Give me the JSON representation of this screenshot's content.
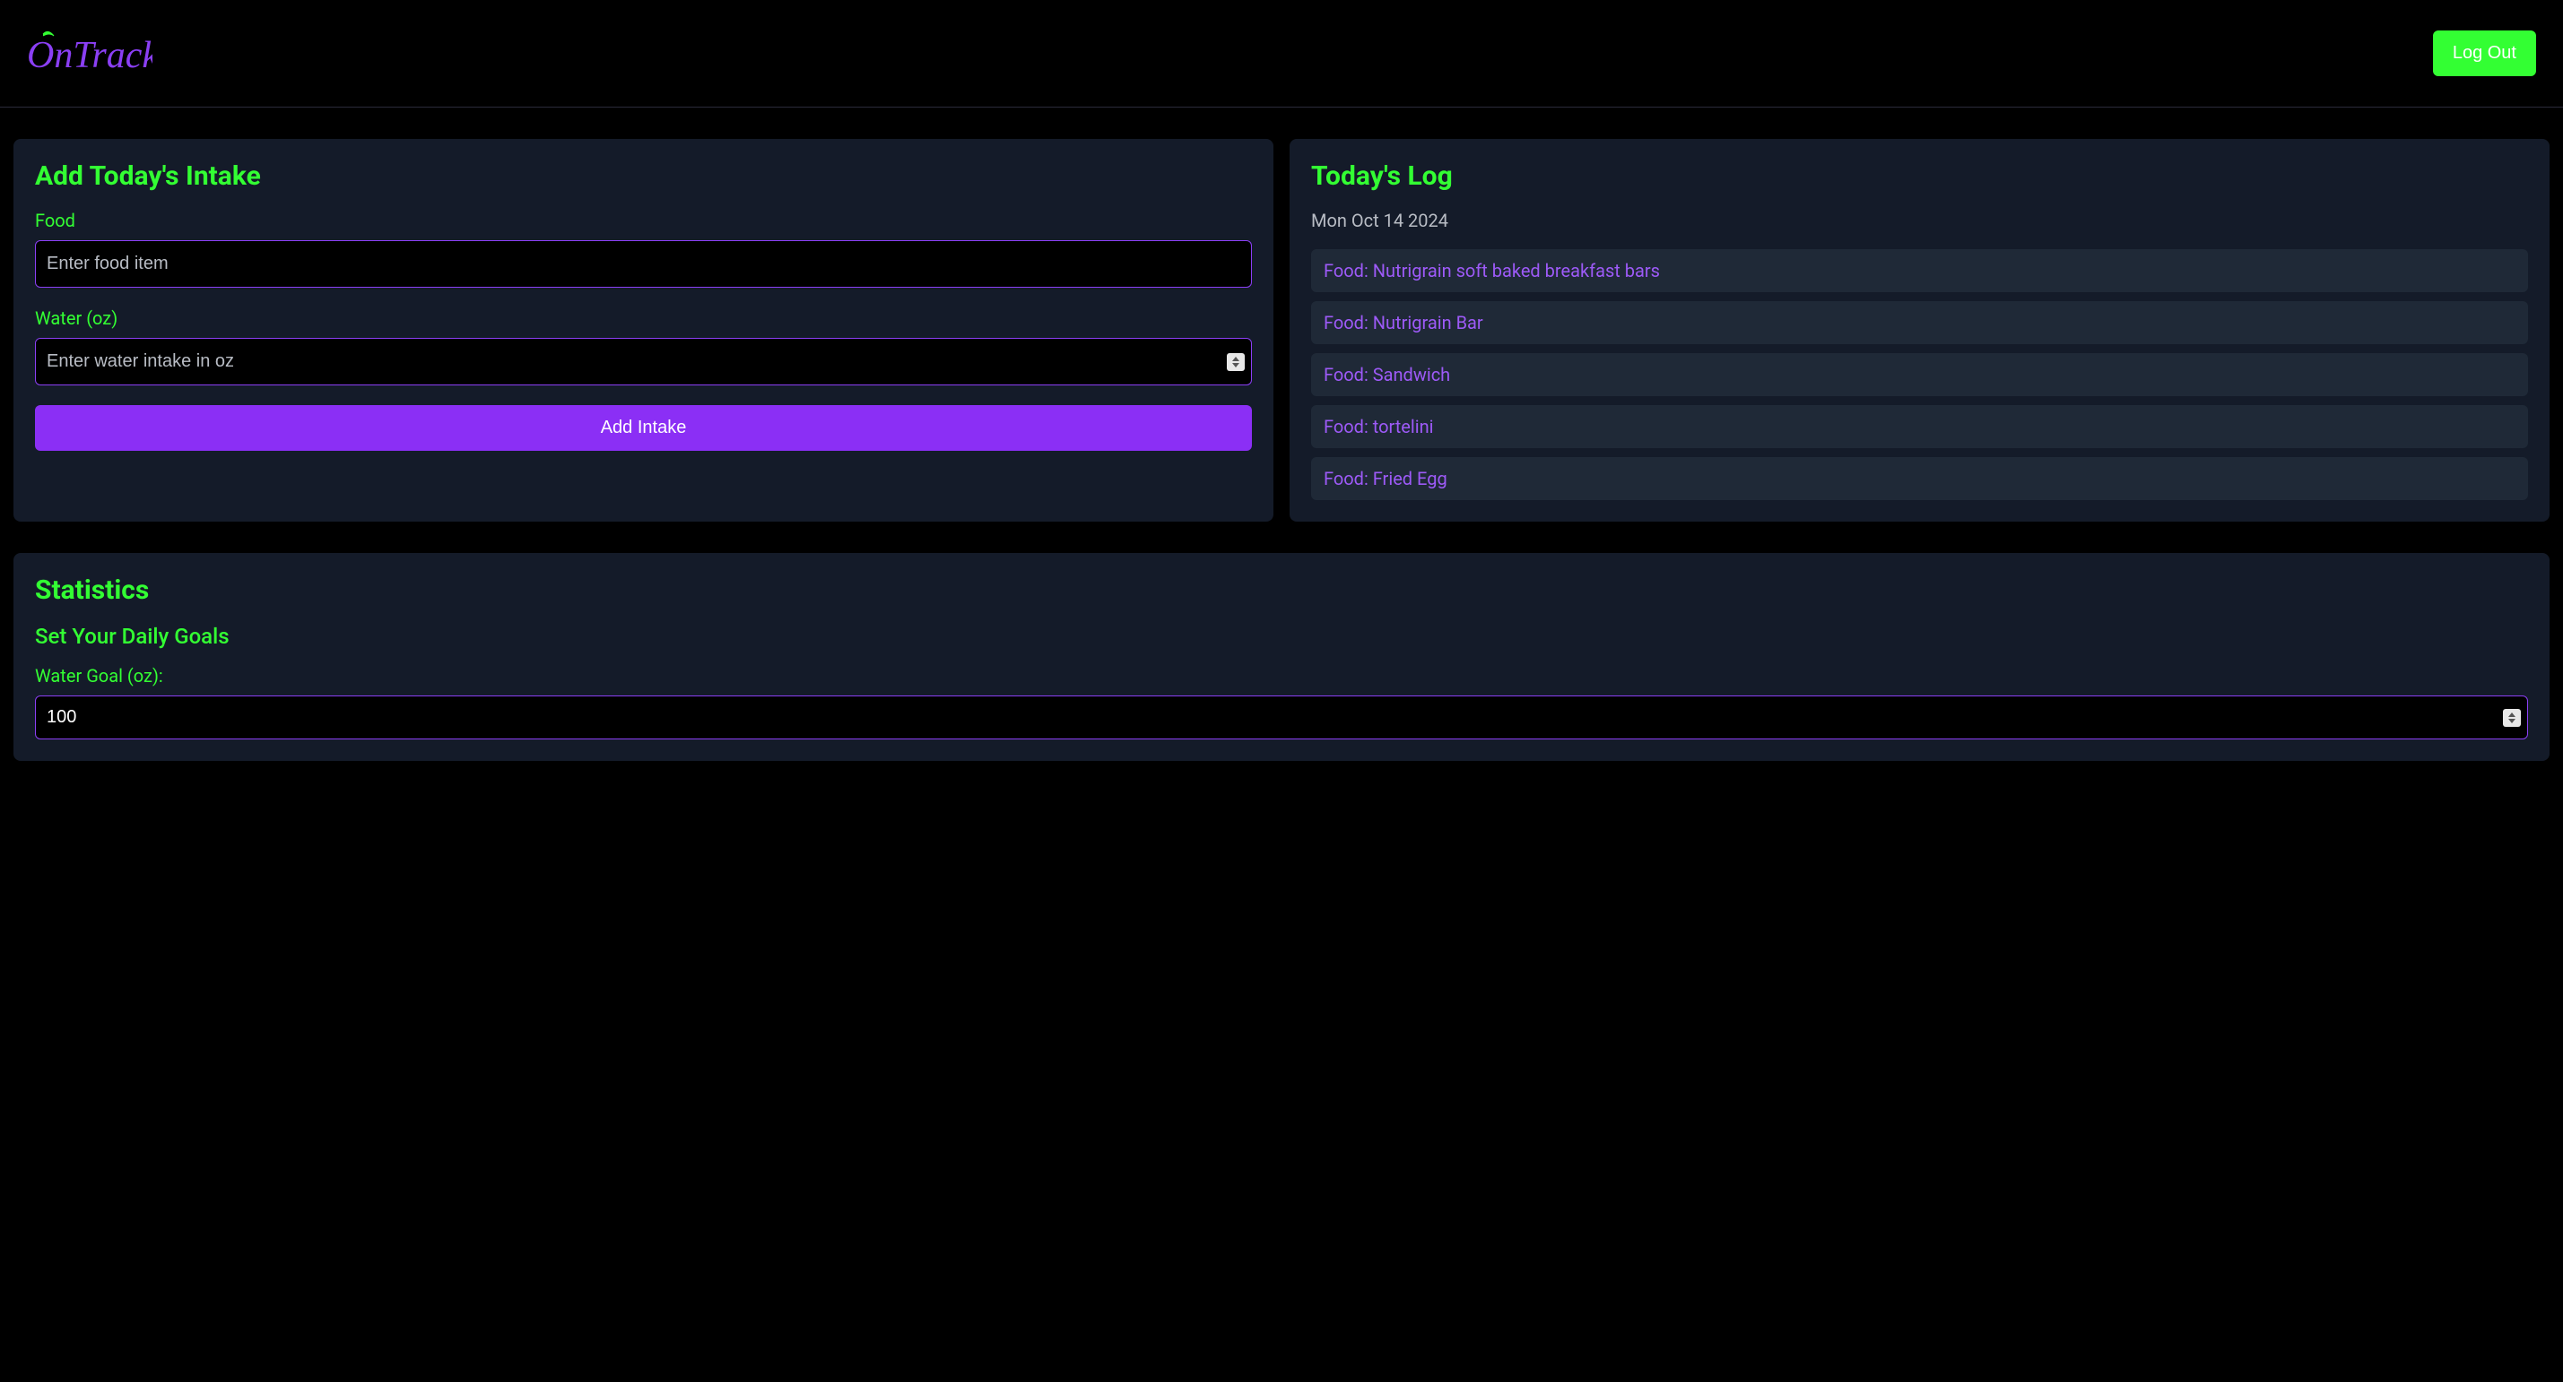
{
  "header": {
    "brand_name": "OnTrack",
    "username": "",
    "logout_label": "Log Out"
  },
  "intake": {
    "title": "Add Today's Intake",
    "food_label": "Food",
    "food_placeholder": "Enter food item",
    "water_label": "Water (oz)",
    "water_placeholder": "Enter water intake in oz",
    "submit_label": "Add Intake"
  },
  "log": {
    "title": "Today's Log",
    "date": "Mon Oct 14 2024",
    "items": [
      "Food: Nutrigrain soft baked breakfast bars",
      "Food: Nutrigrain Bar",
      "Food: Sandwich",
      "Food: tortelini",
      "Food: Fried Egg"
    ]
  },
  "statistics": {
    "title": "Statistics",
    "goals_subtitle": "Set Your Daily Goals",
    "water_goal_label": "Water Goal (oz):",
    "water_goal_value": "100"
  },
  "colors": {
    "background": "#000000",
    "card_bg": "#141b29",
    "log_item_bg": "#1f2937",
    "accent_green": "#33ff33",
    "accent_purple": "#8b2ff5",
    "text_purple": "#9d5af7",
    "border_purple": "#8b3ff5",
    "text_muted": "#b8bcc4"
  }
}
